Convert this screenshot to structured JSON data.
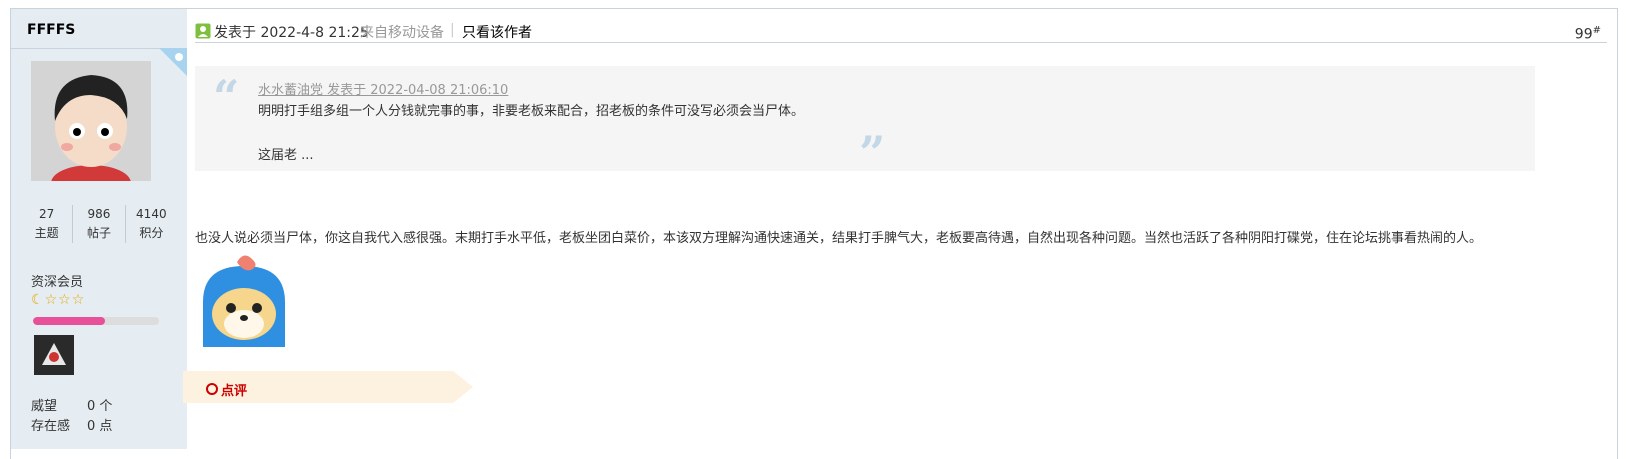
{
  "user": {
    "name": "FFFFS",
    "stats": [
      {
        "value": "27",
        "label": "主题"
      },
      {
        "value": "986",
        "label": "帖子"
      },
      {
        "value": "4140",
        "label": "积分"
      }
    ],
    "grade": "资深会员",
    "level_progress": 0.57,
    "info": [
      {
        "label": "威望",
        "value": "0 个"
      },
      {
        "label": "存在感",
        "value": "0 点"
      }
    ]
  },
  "post": {
    "posted_at": "发表于 2022-4-8 21:25",
    "source": "来自移动设备",
    "separator": "|",
    "author_only": "只看该作者",
    "floor": "99",
    "floor_mark": "#",
    "quote": {
      "meta": "水水蓄油党 发表于 2022-04-08 21:06:10",
      "line1": "明明打手组多组一个人分钱就完事的事，非要老板来配合，招老板的条件可没写必须会当尸体。",
      "line2": "这届老 ..."
    },
    "body": "也没人说必须当尸体，你这自我代入感很强。末期打手水平低，老板坐团白菜价，本该双方理解沟通快速通关，结果打手脾气大，老板要高待遇，自然出现各种问题。当然也活跃了各种阴阳打碟党，住在论坛挑事看热闹的人。",
    "rate_label": "点评"
  },
  "colors": {
    "sidebar_bg": "#e5edf2",
    "accent_red": "#cc0000",
    "progress_pink": "#e8509a",
    "quote_bg": "#f5f5f5"
  }
}
